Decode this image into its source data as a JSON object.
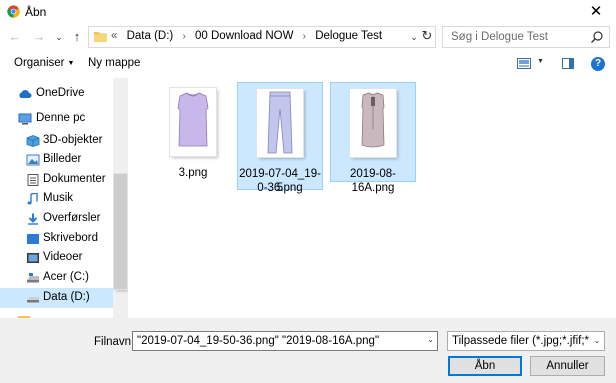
{
  "window": {
    "title": "Åbn",
    "close_glyph": "✕"
  },
  "nav_buttons": {
    "back": "←",
    "forward": "→",
    "recent": "⌄",
    "up": "↑"
  },
  "address": {
    "overflow": "«",
    "crumbs": [
      "Data (D:)",
      "00 Download NOW",
      "Delogue Test"
    ],
    "separator": "›",
    "dropdown": "⌄",
    "refresh": "↻"
  },
  "search": {
    "placeholder": "Søg i Delogue Test"
  },
  "toolbar": {
    "organize": "Organiser",
    "organize_arrow": "▼",
    "new_folder": "Ny mappe",
    "view_arrow": "▼",
    "help": "?"
  },
  "sidebar": {
    "items": [
      {
        "label": "OneDrive",
        "icon": "cloud-icon"
      },
      {
        "label": "Denne pc",
        "icon": "computer-icon"
      },
      {
        "label": "3D-objekter",
        "icon": "cube-icon"
      },
      {
        "label": "Billeder",
        "icon": "pictures-icon"
      },
      {
        "label": "Dokumenter",
        "icon": "document-icon"
      },
      {
        "label": "Musik",
        "icon": "music-icon"
      },
      {
        "label": "Overførsler",
        "icon": "download-icon"
      },
      {
        "label": "Skrivebord",
        "icon": "desktop-icon"
      },
      {
        "label": "Videoer",
        "icon": "video-icon"
      },
      {
        "label": "Acer (C:)",
        "icon": "drive-icon"
      },
      {
        "label": "Data (D:)",
        "icon": "drive-icon",
        "selected": true
      }
    ]
  },
  "files": [
    {
      "name_line1": "3.png",
      "name_line2": "",
      "selected": false,
      "garment": "sleeveless-top"
    },
    {
      "name_line1": "2019-07-04_19-5",
      "name_line2": "0-36.png",
      "selected": true,
      "garment": "pants"
    },
    {
      "name_line1": "2019-08-16A.png",
      "name_line2": "",
      "selected": true,
      "garment": "sleeveless-blouse"
    }
  ],
  "bottom": {
    "filename_label": "Filnavn:",
    "filename_value": "\"2019-07-04_19-50-36.png\" \"2019-08-16A.png\"",
    "filetype_value": "Tilpassede filer (*.jpg;*.jfif;*.pjpe",
    "open_label": "Åbn",
    "cancel_label": "Annuller"
  },
  "colors": {
    "selection": "#cce8ff",
    "selection_border": "#99d1ff",
    "accent": "#0078d7",
    "lavender": "#c7b7ea",
    "mauve": "#c9b9bf"
  }
}
